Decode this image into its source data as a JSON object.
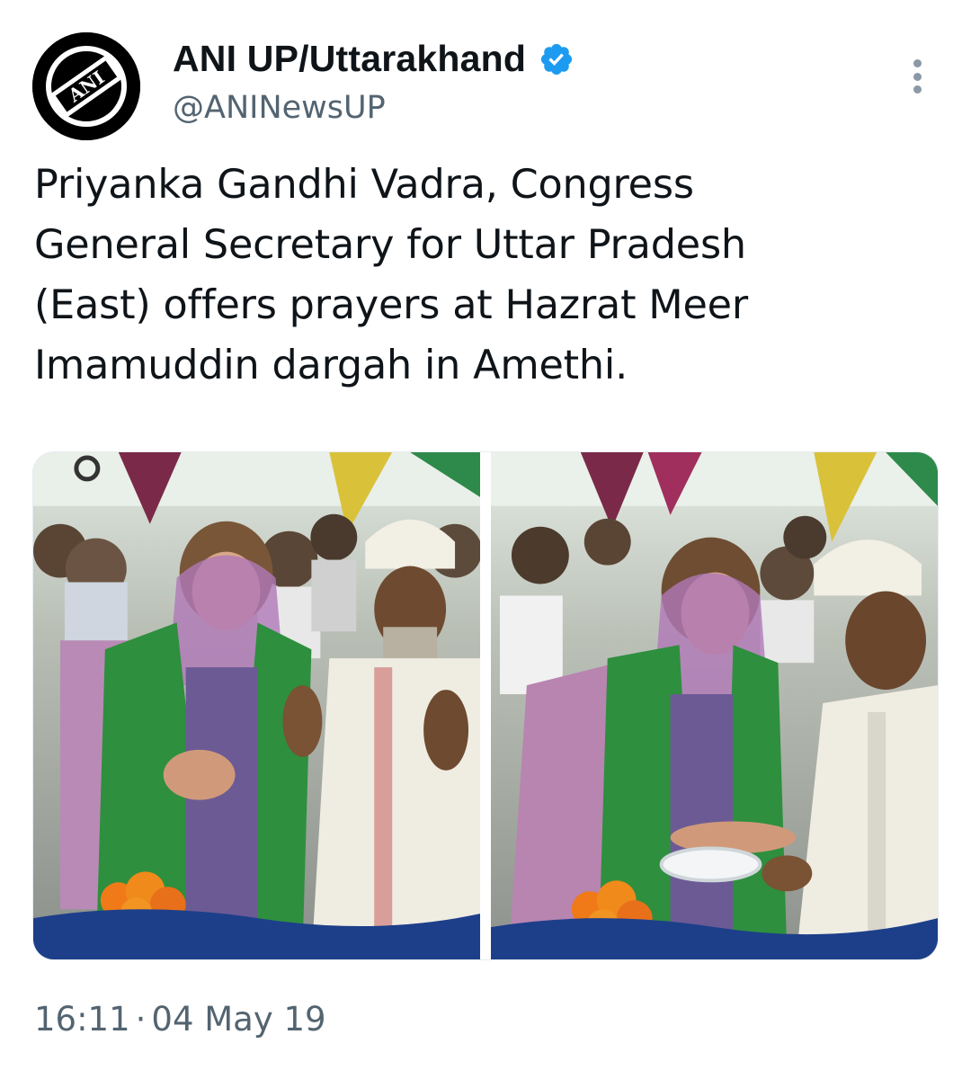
{
  "account": {
    "display_name": "ANI UP/Uttarakhand",
    "handle": "@ANINewsUP",
    "verified": true,
    "avatar_logo_text": "ANI"
  },
  "tweet": {
    "text": "Priyanka Gandhi Vadra, Congress\nGeneral Secretary for Uttar Pradesh\n(East) offers prayers at Hazrat Meer\nImamuddin dargah in Amethi.",
    "time": "16:11",
    "separator": "·",
    "date": "04 May 19"
  },
  "media": {
    "photo_count": 2
  },
  "colors": {
    "text_primary": "#0f1419",
    "text_secondary": "#536471",
    "verified_blue": "#1d9bf0"
  },
  "icons": {
    "verified": "verified-badge-icon",
    "more": "more-options-icon"
  }
}
